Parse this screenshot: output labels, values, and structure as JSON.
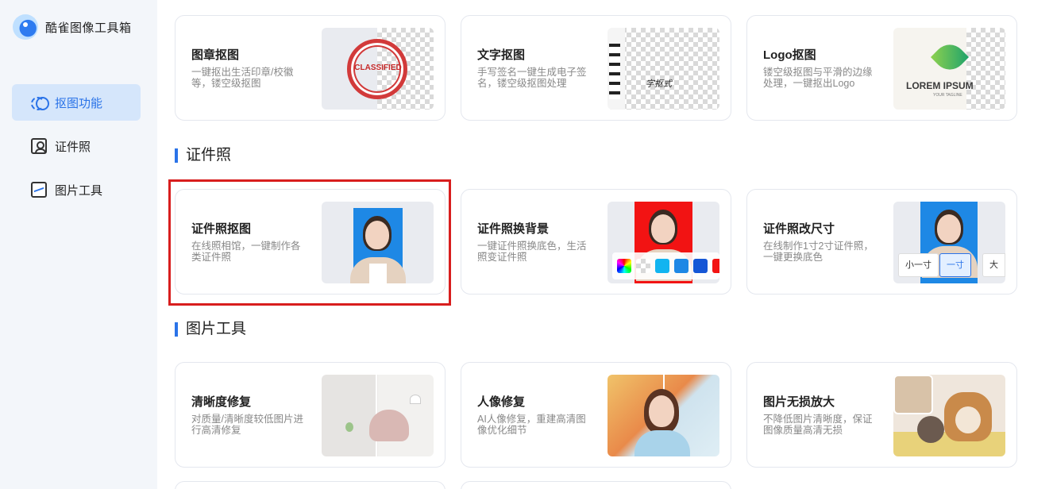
{
  "app": {
    "title": "酷雀图像工具箱"
  },
  "sidebar": {
    "items": [
      {
        "label": "抠图功能",
        "icon": "matting-icon",
        "active": true
      },
      {
        "label": "证件照",
        "icon": "id-photo-icon",
        "active": false
      },
      {
        "label": "图片工具",
        "icon": "image-tool-icon",
        "active": false
      }
    ]
  },
  "sections": {
    "matting": {
      "cards": [
        {
          "title": "图章抠图",
          "desc": "一键抠出生活印章/校徽等，镂空级抠图",
          "thumb_text": "CLASSIFIED"
        },
        {
          "title": "文字抠图",
          "desc": "手写签名一键生成电子签名，镂空级抠图处理",
          "thumb_text": "字抠式"
        },
        {
          "title": "Logo抠图",
          "desc": "镂空级抠图与平滑的边缘处理，一键抠出Logo",
          "thumb_text": "LOREM IPSUM",
          "thumb_subtext": "YOUR TAGLINE"
        }
      ]
    },
    "idphoto": {
      "title": "证件照",
      "cards": [
        {
          "title": "证件照抠图",
          "desc": "在线照相馆，一键制作各类证件照"
        },
        {
          "title": "证件照换背景",
          "desc": "一键证件照换底色，生活照变证件照"
        },
        {
          "title": "证件照改尺寸",
          "desc": "在线制作1寸2寸证件照，一键更换底色",
          "sizes": [
            "小一寸",
            "一寸",
            "大一"
          ]
        }
      ]
    },
    "imagetools": {
      "title": "图片工具",
      "cards": [
        {
          "title": "清晰度修复",
          "desc": "对质量/清晰度较低图片进行高清修复"
        },
        {
          "title": "人像修复",
          "desc": "AI人像修复，重建高清图像优化细节"
        },
        {
          "title": "图片无损放大",
          "desc": "不降低图片清晰度，保证图像质量高清无损"
        }
      ]
    }
  },
  "colors": {
    "accent": "#2a73e8",
    "highlight": "#d81e1e",
    "id_blue": "#1e88e5",
    "id_red": "#f21313"
  }
}
